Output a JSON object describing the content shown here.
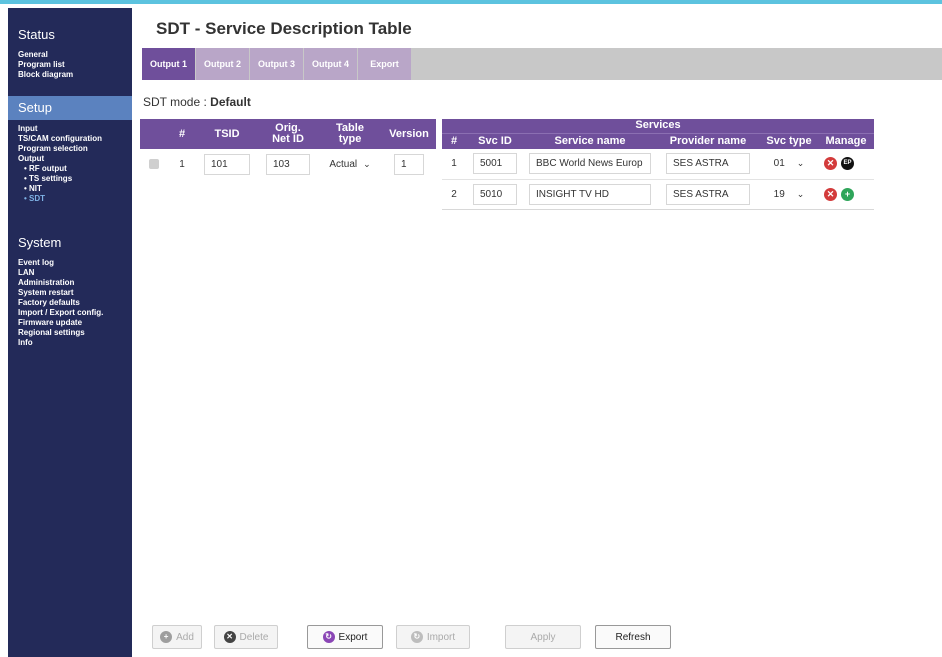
{
  "sidebar": {
    "status_heading": "Status",
    "status_items": [
      "General",
      "Program list",
      "Block diagram"
    ],
    "setup_heading": "Setup",
    "setup_items": [
      "Input",
      "TS/CAM configuration",
      "Program selection",
      "Output"
    ],
    "output_subitems": [
      "• RF output",
      "• TS settings",
      "• NIT",
      "• SDT"
    ],
    "system_heading": "System",
    "system_items": [
      "Event log",
      "LAN",
      "Administration",
      "System restart",
      "Factory defaults",
      "Import / Export config.",
      "Firmware update",
      "Regional settings",
      "Info"
    ]
  },
  "page": {
    "title": "SDT - Service Description Table"
  },
  "tabs": [
    {
      "label": "Output 1",
      "active": true
    },
    {
      "label": "Output 2",
      "active": false
    },
    {
      "label": "Output 3",
      "active": false
    },
    {
      "label": "Output 4",
      "active": false
    },
    {
      "label": "Export",
      "active": false
    }
  ],
  "mode": {
    "label": "SDT mode :",
    "value": "Default"
  },
  "table": {
    "headers": {
      "num": "#",
      "tsid": "TSID",
      "orig_net_id_1": "Orig.",
      "orig_net_id_2": "Net ID",
      "table_type_1": "Table",
      "table_type_2": "type",
      "version": "Version",
      "services": "Services",
      "svc_num": "#",
      "svc_id": "Svc ID",
      "service_name": "Service name",
      "provider_name": "Provider name",
      "svc_type": "Svc type",
      "manage": "Manage"
    },
    "ts_row": {
      "num": "1",
      "tsid": "101",
      "orig_net_id": "103",
      "table_type": "Actual",
      "version": "1"
    },
    "services": [
      {
        "num": "1",
        "svc_id": "5001",
        "service_name": "BBC World News Europ",
        "provider_name": "SES ASTRA",
        "svc_type": "01"
      },
      {
        "num": "2",
        "svc_id": "5010",
        "service_name": "INSIGHT TV HD",
        "provider_name": "SES ASTRA",
        "svc_type": "19"
      }
    ]
  },
  "buttons": {
    "add": "Add",
    "delete": "Delete",
    "export": "Export",
    "import": "Import",
    "apply": "Apply",
    "refresh": "Refresh"
  },
  "icons": {
    "delete_glyph": "✕",
    "info_glyph": "EP",
    "add_glyph": "+",
    "chevron": "⌄"
  },
  "colors": {
    "sidebar_bg": "#232a59",
    "setup_highlight": "#5b82bf",
    "tab_active": "#6f4f9b",
    "tab_inactive": "#b9a6c8",
    "header_bg": "#6f4f9b"
  }
}
